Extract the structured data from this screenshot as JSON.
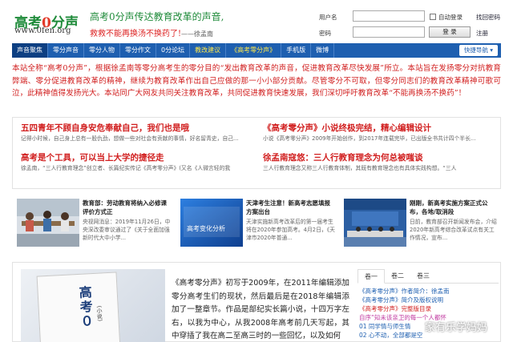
{
  "header": {
    "logo_a": "高考",
    "logo_zero": "0",
    "logo_b": "分声",
    "url": "www.0fen.org",
    "slogan_1": "高考0分声传达教育改革的声音,",
    "slogan_2": "救救不能再换汤不换药了!",
    "signature": "——徐孟南"
  },
  "login": {
    "username_label": "用户名",
    "password_label": "密码",
    "username_value": "",
    "password_value": "",
    "remember_label": "自动登录",
    "login_button": "登 录",
    "forgot_link": "找回密码",
    "register_link": "注册"
  },
  "nav": {
    "items": [
      {
        "label": "声音聚焦"
      },
      {
        "label": "零分声音"
      },
      {
        "label": "零分人物"
      },
      {
        "label": "零分作文"
      },
      {
        "label": "0分论坛"
      },
      {
        "label": "教改建议"
      },
      {
        "label": "《高考零分声》"
      },
      {
        "label": "手机版"
      },
      {
        "label": "微博"
      }
    ],
    "quick_nav": "快捷导航 ▾"
  },
  "intro": {
    "text": "本站全称“高考0分声”，根据徐孟南等零分高考生的零分目的“发出教育改革的声音，促进教育改革尽快发展”所立。本站旨在发扬零分对抗教育弊端、零分促进教育改革的精神，继续为教育改革作出自己应做的那一小小部分贡献。尽管零分不可取，但零分同志们的教育改革精神可歌可泣，此精神值得发扬光大。本站同广大网友共同关注教育改革，共同促进教育快速发展，我们深切呼吁教育改革“不能再换汤不换药”！"
  },
  "headlines": {
    "left": [
      {
        "title": "五四青年不顾自身安危奉献自己，我们也是哦",
        "summary": "记得小时候，自己身上总有一股仇劲，想做一些对社会有贡献的事情，好名留青史，自己..."
      },
      {
        "title": "高考是个工具，可以当上大学的捷径走",
        "summary": "徐孟南，“三人行教育理念”创立者、长篇纪实传记《高考零分声》(又名《人微言轻的我"
      }
    ],
    "right": [
      {
        "title": "《高考零分声》小说终极完结，精心编辑设计",
        "summary": "小说《高考零分声》2009年开始创作，到2017年连载完毕，已出版全书共计四个半长..."
      },
      {
        "title": "徐孟南寇悠：三人行教育理念为何总被嗤谈",
        "summary": "三人行教育理念又称三人行教育体制，其既有教育理念也有具体实践构想。“三人"
      }
    ]
  },
  "middle": [
    {
      "title": "教育部：劳动教育将纳入必修课 评价方式正",
      "desc": "央视网消息：2019年11月26日，中央深改委审议通过了《关于全面加强新时代大中小学..."
    },
    {
      "title": "天津考生注意！新高考志愿填报方案出台",
      "desc": "天津实施新高考改革后的第一届考生将在2020年参加高考。4月2日，《天津市2020年普通..."
    },
    {
      "title": "刚刚，新高考实施方案正式公布，各地/取消段",
      "desc": "日前，教育部召开新闻发布会，介绍2020年新高考综合改革试点有关工作情况，宣布..."
    }
  ],
  "middle_thumbs": {
    "card2_caption": "高考变化分析"
  },
  "book": {
    "title_vertical": "高考０",
    "subtitle_vertical": "(小说)",
    "description": "《高考零分声》初写于2009年，在2011年编辑添加零分高考生们的现状，然后最后是在2018年编辑添加了一整章节。作品是部纪实长篇小说，十四万字左右，以我为中心，从我2008年高考前几天写起，其中穿插了我在高二至高三时的一些回忆，以及如何"
  },
  "sidebar": {
    "tabs": [
      "卷一",
      "卷二",
      "卷三"
    ],
    "items": [
      {
        "text": "《高考零分声》作者简介：徐孟南",
        "color": "#1e5fb0"
      },
      {
        "text": "《高考零分声》简介及版权说明",
        "color": "#1e5fb0"
      },
      {
        "text": "《高考零分声》完整版目录",
        "color": "#d11f1f"
      },
      {
        "text": "自序“知未该亲卫的每一个人都怀",
        "color": "#c03aa0"
      },
      {
        "text": "01 同学情与师生情",
        "color": "#1e5fb0"
      },
      {
        "text": "02 心不动，全部都是空",
        "color": "#1e5fb0"
      }
    ]
  },
  "watermark": "家有乐学妈妈"
}
